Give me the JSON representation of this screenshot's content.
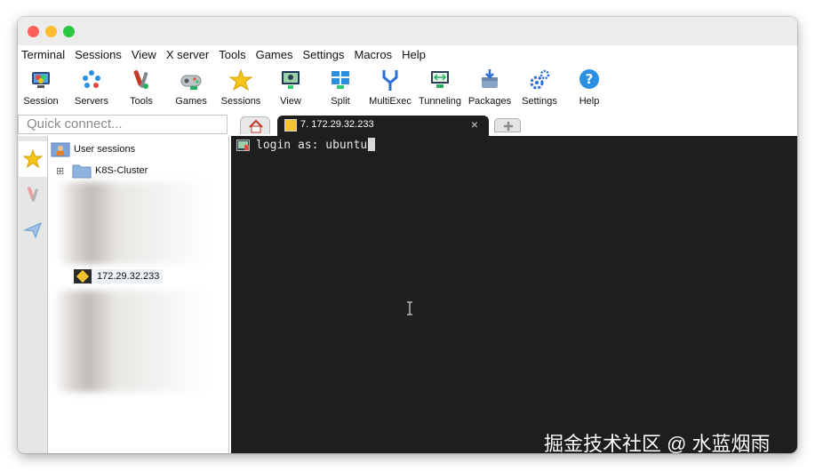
{
  "menu": [
    "Terminal",
    "Sessions",
    "View",
    "X server",
    "Tools",
    "Games",
    "Settings",
    "Macros",
    "Help"
  ],
  "toolbar": {
    "session": "Session",
    "servers": "Servers",
    "tools": "Tools",
    "games": "Games",
    "sessions": "Sessions",
    "view": "View",
    "split": "Split",
    "multiexec": "MultiExec",
    "tunneling": "Tunneling",
    "packages": "Packages",
    "settings": "Settings",
    "help": "Help"
  },
  "quick_connect": {
    "placeholder": "Quick connect..."
  },
  "tabs": {
    "active_label": "7. 172.29.32.233",
    "close_glyph": "×"
  },
  "sessions_tree": {
    "root_label": "User sessions",
    "folder_label": "K8S-Cluster",
    "expander": "⊞",
    "session_label": "172.29.32.233"
  },
  "terminal": {
    "line": "login as: ubuntu"
  },
  "watermark": "掘金技术社区 @ 水蓝烟雨",
  "colors": {
    "terminal_bg": "#1e1e1e",
    "accent_blue": "#2a8fe0"
  }
}
